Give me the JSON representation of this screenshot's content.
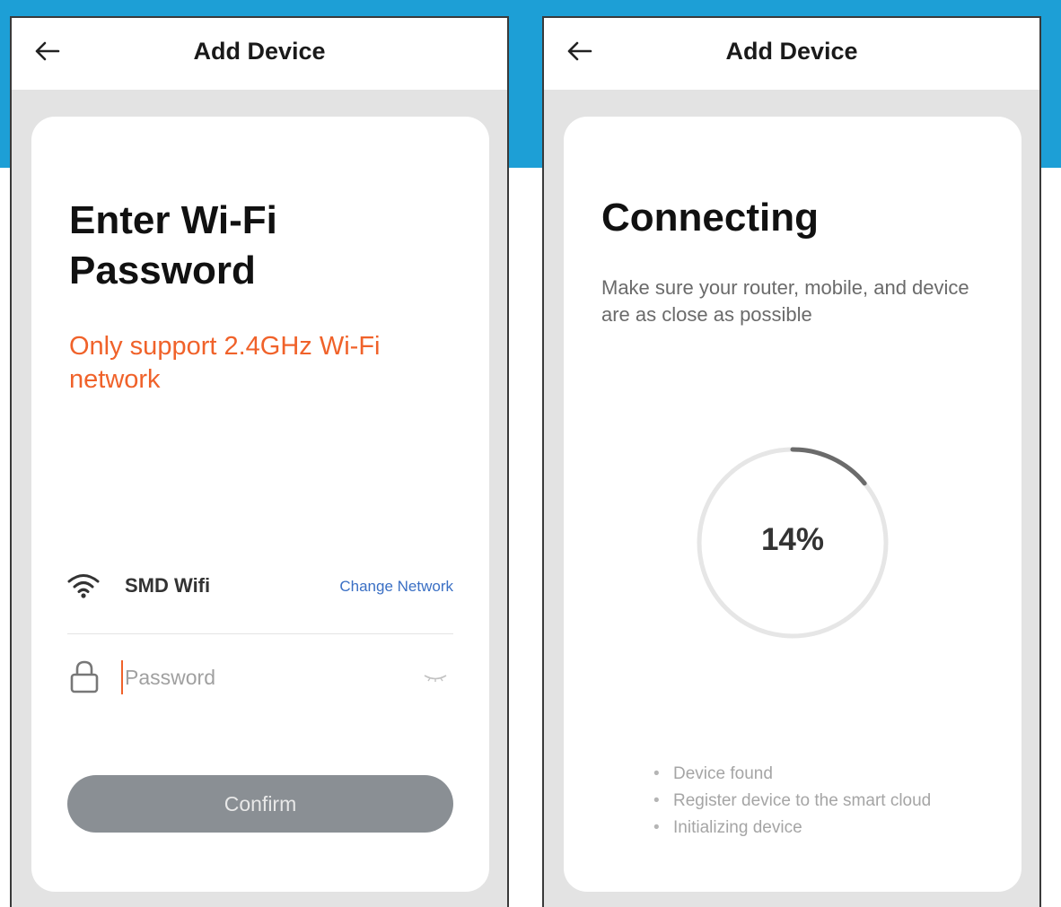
{
  "screens": [
    {
      "topbar": {
        "title": "Add Device"
      },
      "heading": "Enter Wi-Fi Password",
      "warning": "Only support 2.4GHz Wi-Fi network",
      "network": {
        "name": "SMD Wifi",
        "change_label": "Change Network"
      },
      "password": {
        "placeholder": "Password",
        "value": ""
      },
      "confirm_label": "Confirm"
    },
    {
      "topbar": {
        "title": "Add Device"
      },
      "heading": "Connecting",
      "subtext": "Make sure your router, mobile, and device are as close as possible",
      "progress": {
        "value": 0.14,
        "label": "14%"
      },
      "steps": [
        "Device found",
        "Register device to the smart cloud",
        "Initializing device"
      ]
    }
  ],
  "colors": {
    "header_band": "#1d9fd6",
    "warning": "#f0622a",
    "link": "#3a6fc4",
    "button": "#8a8f94",
    "progress_arc": "#6b6b6b",
    "progress_track": "#e6e6e6"
  },
  "icons": [
    "back-arrow-icon",
    "wifi-icon",
    "lock-icon",
    "eye-icon"
  ]
}
